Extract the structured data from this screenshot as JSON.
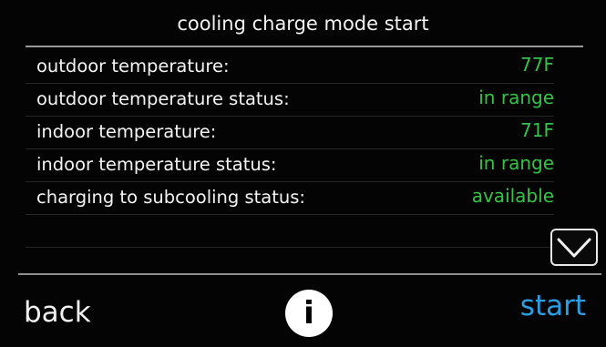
{
  "header": {
    "title": "cooling charge mode start"
  },
  "status_rows": [
    {
      "label": "outdoor temperature:",
      "value": "77F"
    },
    {
      "label": "outdoor temperature status:",
      "value": "in range"
    },
    {
      "label": "indoor temperature:",
      "value": "71F"
    },
    {
      "label": "indoor temperature status:",
      "value": "in range"
    },
    {
      "label": "charging to subcooling status:",
      "value": "available"
    }
  ],
  "footer": {
    "back_label": "back",
    "info_label": "i",
    "start_label": "start"
  },
  "colors": {
    "value_green": "#33c447",
    "start_blue": "#2a9fe6",
    "text_white": "#f4f4f4"
  },
  "icons": {
    "scroll_down": "chevron-down-icon",
    "info": "info-icon"
  }
}
